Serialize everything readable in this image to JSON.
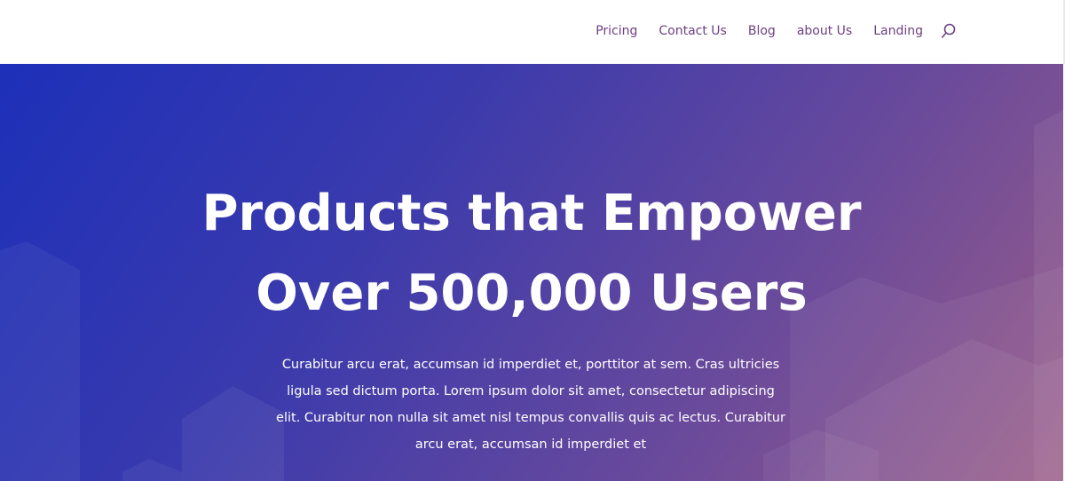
{
  "nav": {
    "items": [
      {
        "label": "Pricing",
        "name": "nav-pricing"
      },
      {
        "label": "Contact Us",
        "name": "nav-contact-us"
      },
      {
        "label": "Blog",
        "name": "nav-blog"
      },
      {
        "label": "about Us",
        "name": "nav-about-us"
      },
      {
        "label": "Landing",
        "name": "nav-landing"
      }
    ],
    "search_icon": "search-icon"
  },
  "hero": {
    "title_line1": "Products that Empower",
    "title_line2": "Over 500,000 Users",
    "body": "Curabitur arcu erat, accumsan id imperdiet et, porttitor at sem. Cras ultricies ligula sed dictum porta. Lorem ipsum dolor sit amet, consectetur adipiscing elit. Curabitur non nulla sit amet nisl tempus convallis quis ac lectus. Curabitur arcu erat, accumsan id imperdiet et"
  },
  "colors": {
    "nav_text": "#6d3f82",
    "hero_start": "#1d30b9",
    "hero_end": "#9a5d88",
    "text_light": "#ffffff"
  }
}
